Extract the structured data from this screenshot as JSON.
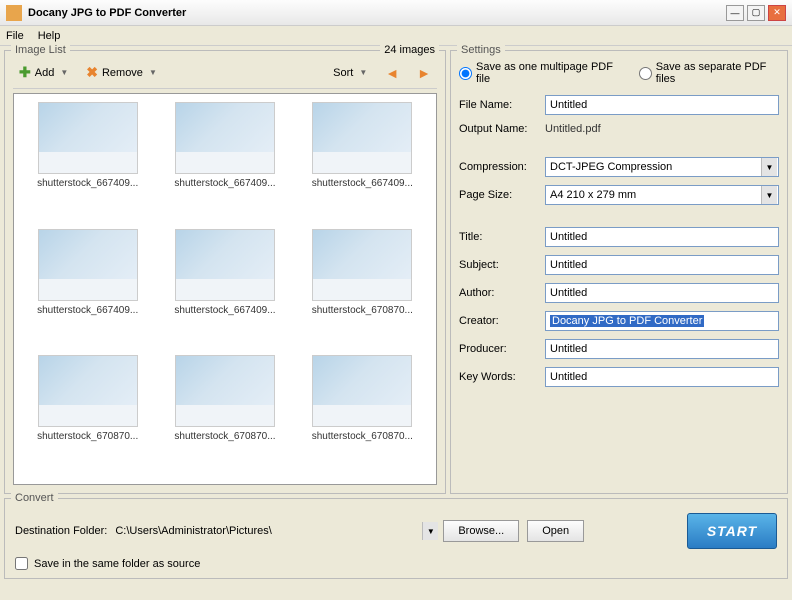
{
  "window": {
    "title": "Docany JPG to PDF Converter"
  },
  "menu": {
    "file": "File",
    "help": "Help"
  },
  "imageList": {
    "title": "Image List",
    "count": "24 images",
    "addLabel": "Add",
    "removeLabel": "Remove",
    "sortLabel": "Sort",
    "thumbs": [
      "shutterstock_667409...",
      "shutterstock_667409...",
      "shutterstock_667409...",
      "shutterstock_667409...",
      "shutterstock_667409...",
      "shutterstock_670870...",
      "shutterstock_670870...",
      "shutterstock_670870...",
      "shutterstock_670870..."
    ]
  },
  "settings": {
    "title": "Settings",
    "radio1": "Save as one multipage PDF file",
    "radio2": "Save as separate PDF files",
    "fileNameLabel": "File Name:",
    "fileName": "Untitled",
    "outputNameLabel": "Output Name:",
    "outputName": "Untitled.pdf",
    "compressionLabel": "Compression:",
    "compression": "DCT-JPEG Compression",
    "pageSizeLabel": "Page Size:",
    "pageSize": "A4 210 x 279 mm",
    "titleLabel": "Title:",
    "titleVal": "Untitled",
    "subjectLabel": "Subject:",
    "subject": "Untitled",
    "authorLabel": "Author:",
    "author": "Untitled",
    "creatorLabel": "Creator:",
    "creator": "Docany JPG to PDF Converter",
    "producerLabel": "Producer:",
    "producer": "Untitled",
    "keywordsLabel": "Key Words:",
    "keywords": "Untitled"
  },
  "convert": {
    "title": "Convert",
    "destLabel": "Destination Folder:",
    "dest": "C:\\Users\\Administrator\\Pictures\\",
    "browse": "Browse...",
    "open": "Open",
    "start": "START",
    "sameFolder": "Save in the same folder as source"
  }
}
